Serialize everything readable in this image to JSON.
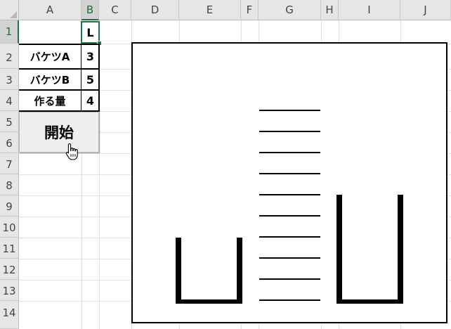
{
  "columns": [
    "A",
    "B",
    "C",
    "D",
    "E",
    "F",
    "G",
    "H",
    "I",
    "J"
  ],
  "rows": [
    "1",
    "2",
    "3",
    "4",
    "5",
    "6",
    "7",
    "8",
    "9",
    "10",
    "11",
    "12",
    "13",
    "14"
  ],
  "cells": {
    "b1": "L",
    "a2": "バケツA",
    "b2": "3",
    "a3": "バケツB",
    "b3": "5",
    "a4": "作る量",
    "b4": "4"
  },
  "button": {
    "label": "開始"
  },
  "icons": {
    "cursor": "hand-pointer-icon"
  },
  "scene": {
    "bucket_a_capacity": 3,
    "bucket_b_capacity": 5,
    "target_amount": 4,
    "gauge_marks": 10
  }
}
